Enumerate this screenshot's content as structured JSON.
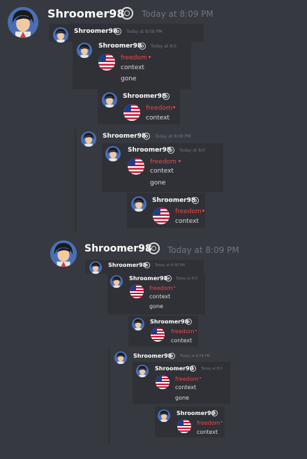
{
  "message": {
    "username": "Shroomer98",
    "timestamp_full": "Today at 8:09 PM",
    "timestamp_mid": "Today at 8:08 PM",
    "timestamp_short": "Today at 8:0"
  },
  "reply": {
    "line1": "freedom",
    "line2": "context",
    "line3": "gone"
  },
  "colors": {
    "background": "#36393f",
    "panel": "#2f3136",
    "username": "#ffffff",
    "timestamp": "#72767d",
    "freedom_text": "#f04747"
  },
  "icons": {
    "badge": "spiral-badge-icon",
    "avatar": "anime-avatar",
    "flag": "us-flag-sphere-icon"
  }
}
